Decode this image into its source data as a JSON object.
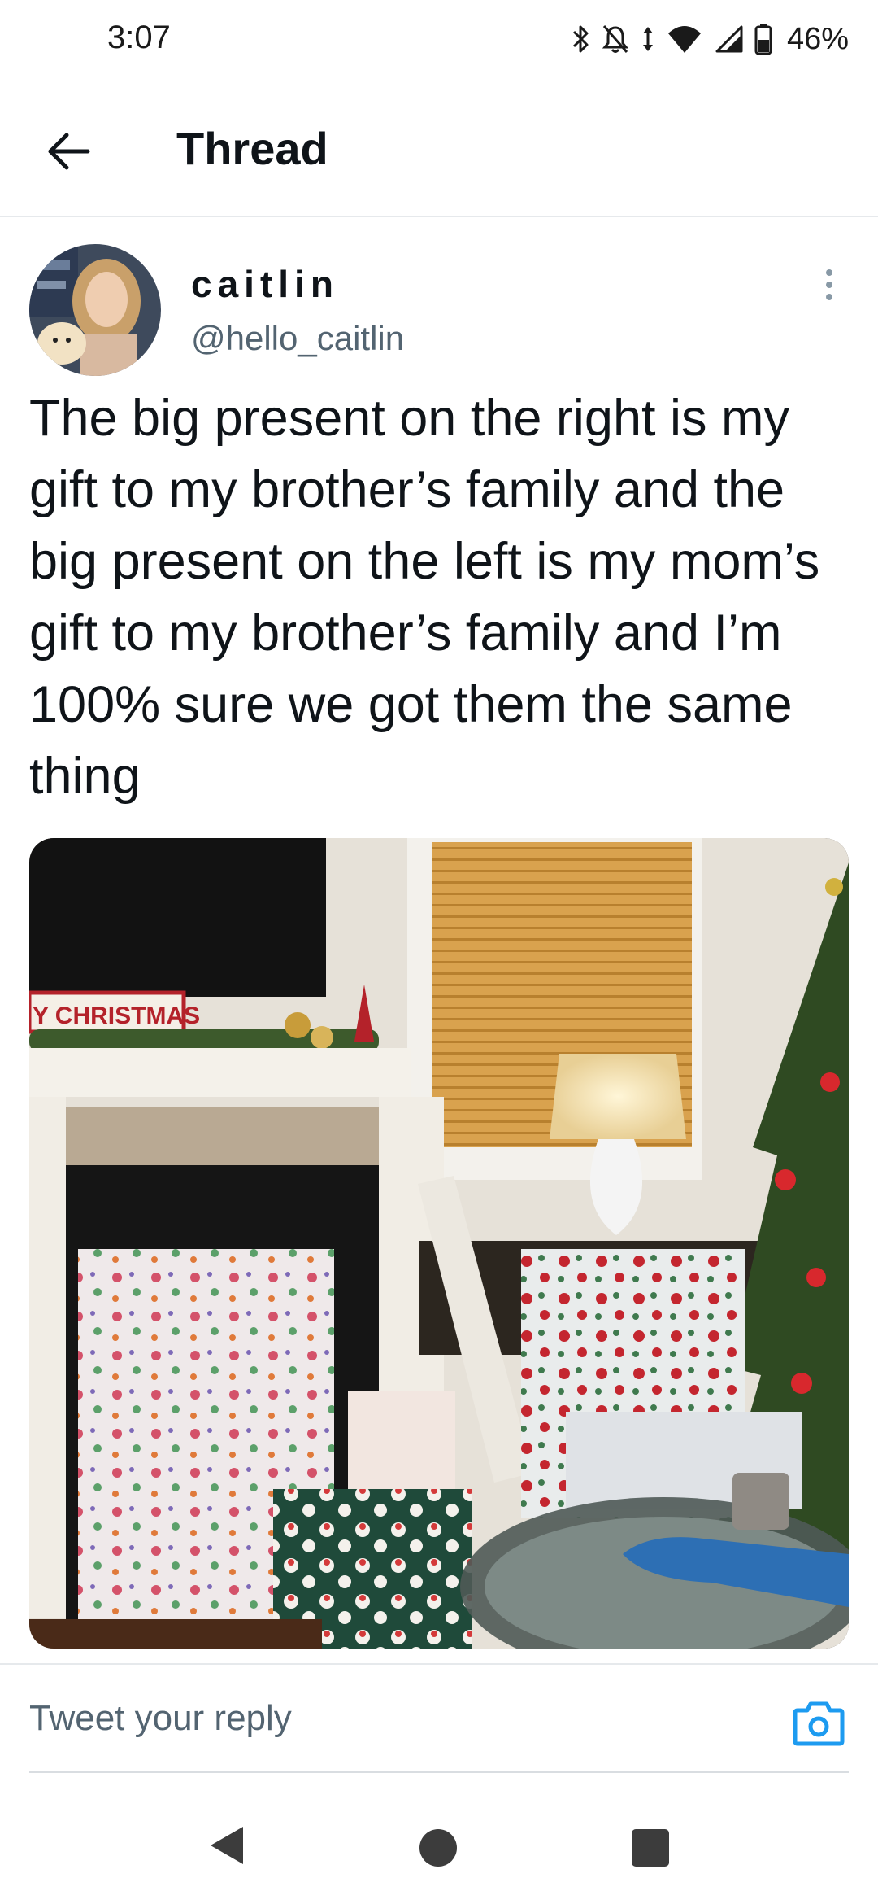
{
  "status_bar": {
    "time": "3:07",
    "battery_percent": "46%",
    "icons": [
      "bluetooth-icon",
      "notifications-muted-icon",
      "data-arrows-icon",
      "wifi-icon",
      "signal-icon",
      "battery-icon"
    ]
  },
  "header": {
    "title": "Thread",
    "back_icon": "arrow-left-icon"
  },
  "tweet": {
    "display_name": "caitlin",
    "handle": "@hello_caitlin",
    "text": "The big present on the right is my gift to my brother’s family and the big present on the left is my mom’s gift to my brother’s family and I’m 100% sure we got them the same thing",
    "more_icon": "more-vertical-icon",
    "media_sign_text": "Y CHRISTMAS"
  },
  "reply": {
    "placeholder": "Tweet your reply",
    "camera_icon": "camera-icon"
  },
  "nav_bar": {
    "icons": [
      "back-triangle-icon",
      "home-circle-icon",
      "recents-square-icon"
    ]
  },
  "colors": {
    "text_primary": "#0f1419",
    "text_secondary": "#536471",
    "accent": "#1d9bf0",
    "divider": "#e6e9ec"
  }
}
